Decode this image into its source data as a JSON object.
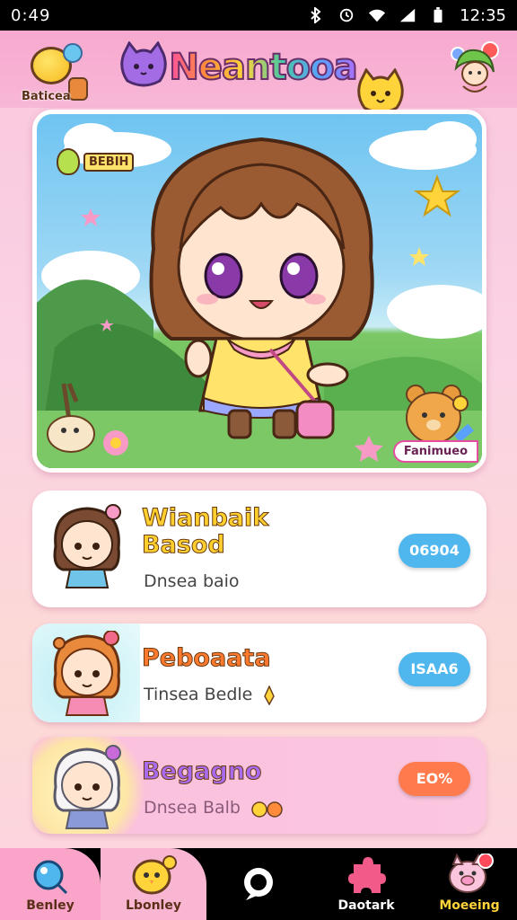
{
  "status_bar": {
    "time_left": "0:49",
    "time_right": "12:35"
  },
  "header": {
    "left_badge": "Baticea",
    "title": "Neantooa"
  },
  "hero": {
    "tag": "BEBIH",
    "badge": "Fanimueo"
  },
  "cards": [
    {
      "title_line1": "Wianbaik",
      "title_line2": "Basod",
      "subtitle": "Dnsea baio",
      "pill": "06904"
    },
    {
      "title_line1": "Peboaata",
      "subtitle": "Tinsea Bedle",
      "pill": "ISAA6"
    },
    {
      "title_line1": "Begagno",
      "subtitle": "Dnsea Balb",
      "pill": "EO%"
    }
  ],
  "tab_bar": {
    "items": [
      {
        "label": "Benley",
        "icon": "balloon-icon"
      },
      {
        "label": "Lbonley",
        "icon": "chick-icon"
      },
      {
        "label": "",
        "icon": "chat-bubble-icon"
      },
      {
        "label": "Daotark",
        "icon": "puzzle-icon"
      },
      {
        "label": "Moeeing",
        "icon": "pig-icon"
      }
    ]
  },
  "colors": {
    "header_pink": "#f7a9cf",
    "pill_blue": "#4fb7ee",
    "pill_orange": "#ff7a4d",
    "tab_bar": "#000000"
  }
}
